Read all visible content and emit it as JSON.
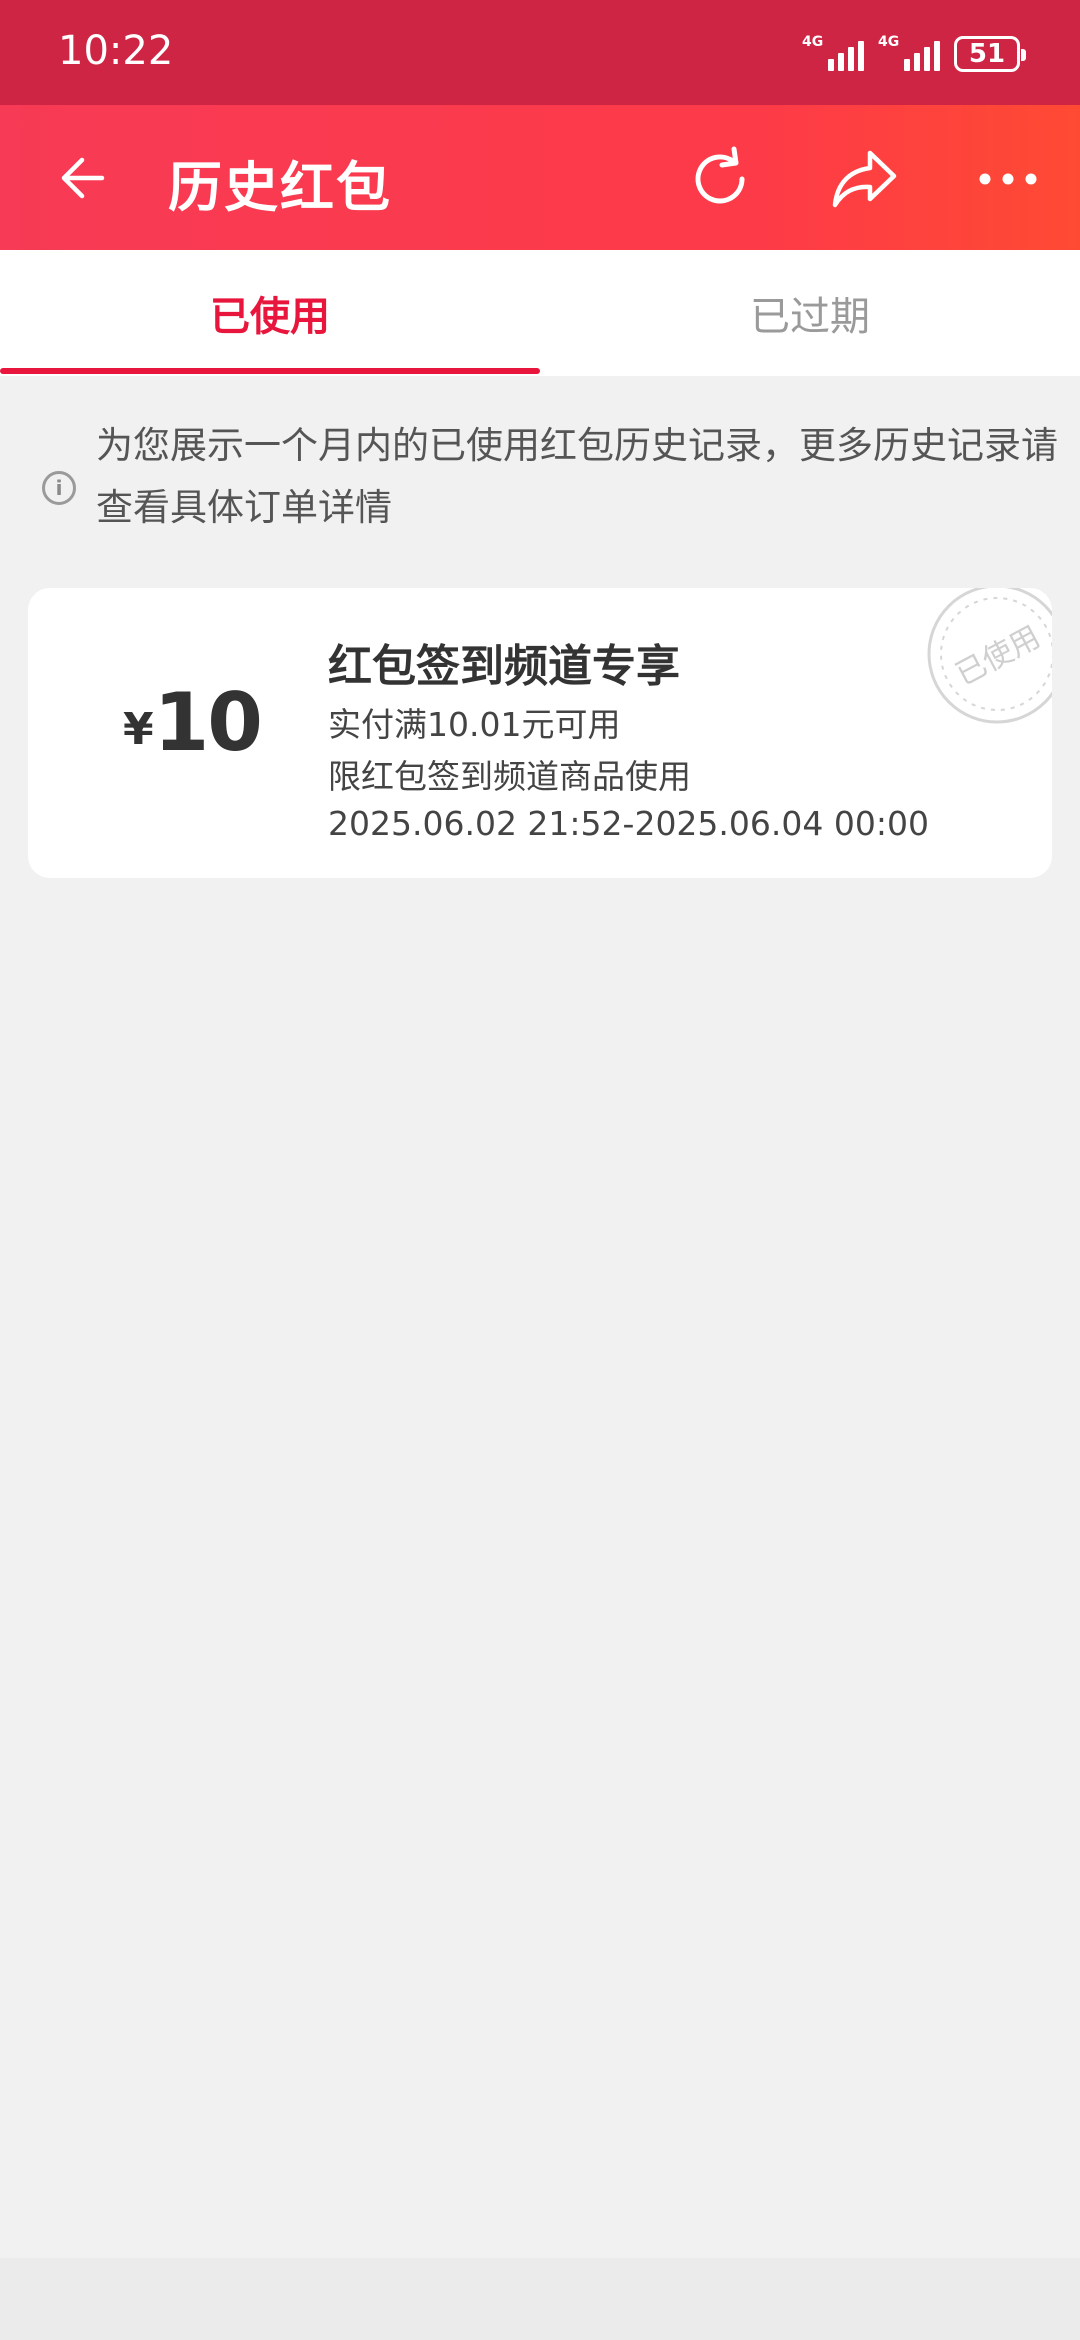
{
  "status_bar": {
    "time": "10:22",
    "signal1_label": "4G",
    "signal2_label": "4G",
    "battery": "51"
  },
  "header": {
    "title": "历史红包",
    "icons": [
      "back-arrow-icon",
      "refresh-icon",
      "share-icon",
      "more-icon"
    ]
  },
  "tabs": [
    {
      "label": "已使用",
      "active": true
    },
    {
      "label": "已过期",
      "active": false
    }
  ],
  "notice": {
    "text": "为您展示一个月内的已使用红包历史记录，更多历史记录请查看具体订单详情"
  },
  "coupon": {
    "currency": "¥",
    "amount": "10",
    "title": "红包签到频道专享",
    "condition": "实付满10.01元可用",
    "scope": "限红包签到频道商品使用",
    "validity": "2025.06.02 21:52-2025.06.04 00:00",
    "stamp_text": "已使用"
  },
  "colors": {
    "accent": "#e8163c",
    "header_start": "#f73a55",
    "header_end": "#ff4a33",
    "status_bar": "#cf2545"
  }
}
